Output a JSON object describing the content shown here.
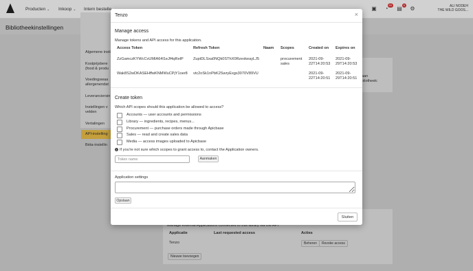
{
  "background": {
    "nav": [
      "Producten",
      "Inkoop",
      "Intern bestelle"
    ],
    "user": {
      "name": "ALI NODEH",
      "company": "THE WILD GOOS..."
    },
    "badges": [
      "59",
      "8",
      "10"
    ],
    "page_title": "Bibliotheekinstellingen",
    "sidebar": [
      "Algemene insti",
      "Kostprijsbere (food & produ",
      "Voedingswaa allergenendat",
      "Leveranciersin",
      "Instellingen v velden",
      "Vertalingen",
      "API-instelling",
      "Bèta-instellin"
    ],
    "main_text": [
      "aan",
      "bliotheek:"
    ],
    "bottom": {
      "intro": "Manage external Applications connected to this library via the API",
      "headers": [
        "Applicatie",
        "Last requested access",
        "Acties"
      ],
      "row": {
        "app": "Tenzo",
        "buttons": [
          "Beheren",
          "Revoke access"
        ]
      },
      "new_button": "Nieuwe toevoegen"
    }
  },
  "modal": {
    "title": "Tenzo",
    "close": "×",
    "manage": {
      "title": "Manage access",
      "description": "Manage tokens and API access for this application.",
      "headers": [
        "Access Token",
        "Refresh Token",
        "Naam",
        "Scopes",
        "Created on",
        "Expires on"
      ],
      "rows": [
        {
          "access": "ZzGamczKYWcCvUMIA64l1eJf4qRelP",
          "refresh": "ZuptDLSxa0NQk0SThX0RzexkeayLJ5",
          "name": "",
          "scopes": [
            "procurement",
            "sales"
          ],
          "created": [
            "2021-09-",
            "22T14:20:53"
          ],
          "expires": [
            "2021-09-",
            "29T14:20:53"
          ]
        },
        {
          "access": "Wak8S2wDKASEHffwKNMWuCPjY1oer8",
          "refresh": "vtc2oSk1nPbK2SwryExgs3070V89VU",
          "name": "",
          "scopes": [],
          "created": [
            "2021-09-",
            "22T14:20:51"
          ],
          "expires": [
            "2021-09-",
            "29T14:20:51"
          ]
        }
      ]
    },
    "create": {
      "title": "Create token",
      "question": "Which API scopes should this application be allowed to access?",
      "scopes": [
        "Accounts — user accounts and permissions",
        "Library — ingredients, recipes, menus...",
        "Procurement — purchase orders made through Apicbase",
        "Sales — read and create sales data",
        "Media — access images uploaded to Apicbase"
      ],
      "hint": "If you're not sure which scopes to grant access to, contact the Application owners.",
      "token_placeholder": "Token name",
      "create_button": "Aanmaken"
    },
    "settings": {
      "title": "Application settings",
      "save_button": "Opslaan"
    },
    "close_button": "Sluiten"
  }
}
